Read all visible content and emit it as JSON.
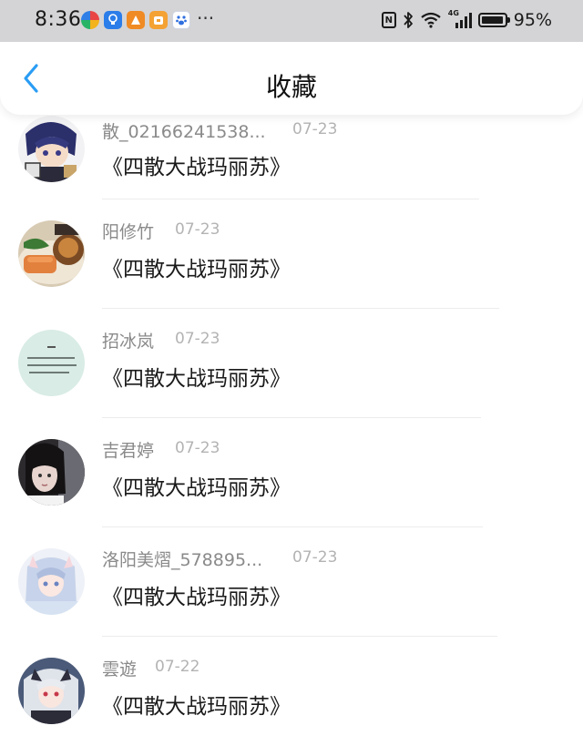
{
  "status_bar": {
    "time": "8:36",
    "more": "···",
    "nfc": "N",
    "network": "4G",
    "battery": "95%",
    "battery_level": 0.95
  },
  "header": {
    "title": "收藏"
  },
  "items": [
    {
      "user": "散_02166241538...",
      "date": "07-23",
      "title": "《四散大战玛丽苏》"
    },
    {
      "user": "阳修竹",
      "date": "07-23",
      "title": "《四散大战玛丽苏》"
    },
    {
      "user": "招冰岚",
      "date": "07-23",
      "title": "《四散大战玛丽苏》"
    },
    {
      "user": "吉君婷",
      "date": "07-23",
      "title": "《四散大战玛丽苏》"
    },
    {
      "user": "洛阳美熠_578895...",
      "date": "07-23",
      "title": "《四散大战玛丽苏》"
    },
    {
      "user": "雲遊",
      "date": "07-22",
      "title": "《四散大战玛丽苏》"
    }
  ]
}
